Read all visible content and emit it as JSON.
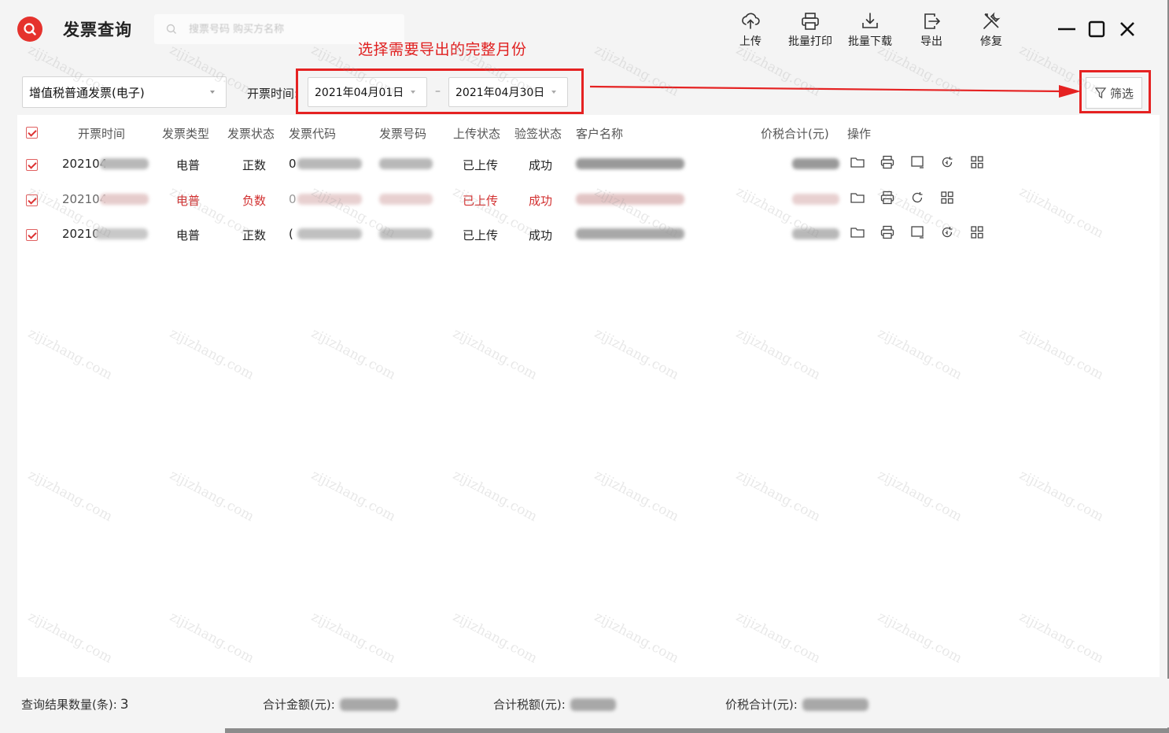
{
  "app": {
    "title": "发票查询",
    "brand_color": "#e5322d"
  },
  "search": {
    "placeholder": "搜票号码 购买方名称"
  },
  "annotation": {
    "text": "选择需要导出的完整月份",
    "color": "#e02020"
  },
  "toolbar": {
    "upload_label": "上传",
    "batch_print_label": "批量打印",
    "batch_download_label": "批量下载",
    "export_label": "导出",
    "repair_label": "修复"
  },
  "filter": {
    "invoice_type_value": "增值税普通发票(电子)",
    "date_label": "开票时间:",
    "start_date": "2021年04月01日",
    "date_separator": "–",
    "end_date": "2021年04月30日",
    "filter_button_label": "筛选"
  },
  "table": {
    "headers": {
      "time": "开票时间",
      "type": "发票类型",
      "status": "发票状态",
      "code": "发票代码",
      "number": "发票号码",
      "upload_status": "上传状态",
      "verify_status": "验签状态",
      "customer": "客户名称",
      "total": "价税合计(元)",
      "ops": "操作"
    },
    "rows": [
      {
        "time": "202104",
        "type": "电普",
        "status": "正数",
        "code": "0",
        "upload": "已上传",
        "verify": "成功",
        "red": false
      },
      {
        "time": "202104",
        "type": "电普",
        "status": "负数",
        "code": "0",
        "upload": "已上传",
        "verify": "成功",
        "red": true
      },
      {
        "time": "20210",
        "type": "电普",
        "status": "正数",
        "code": "(",
        "upload": "已上传",
        "verify": "成功",
        "red": false
      }
    ]
  },
  "footer": {
    "count_label": "查询结果数量(条):",
    "count_value": "3",
    "amount_label": "合计金额(元):",
    "tax_label": "合计税额(元):",
    "total_label": "价税合计(元):"
  },
  "watermark": "zijizhang.com"
}
